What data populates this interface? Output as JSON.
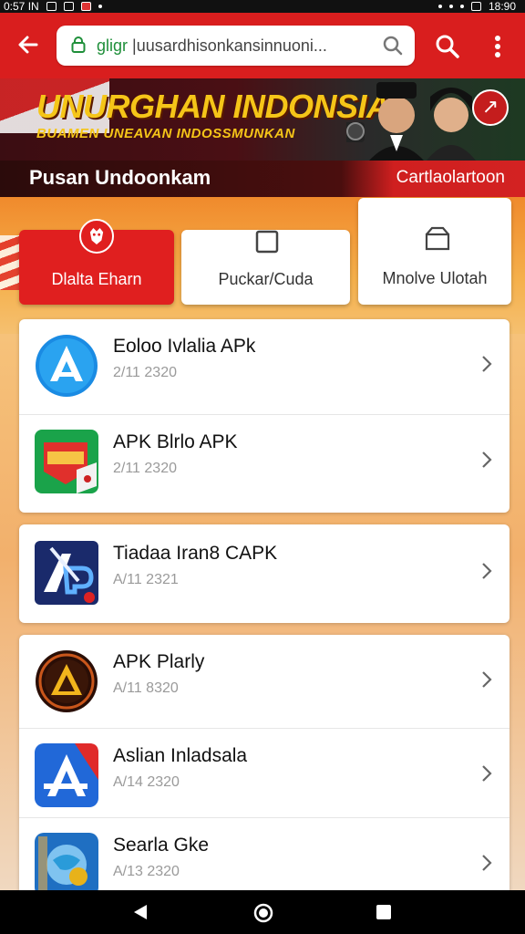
{
  "status": {
    "time_left": "0:57 IN",
    "time_right": "18:90"
  },
  "browser": {
    "url_prefix": "gligr",
    "url_rest": "|uusardhisonkansinnuoni..."
  },
  "banner": {
    "headline": "UNURGHAN INDONSIA",
    "subline": "BUAMEN UNEAVAN INDOSSMUNKAN",
    "bottom_left": "Pusan Undoonkam",
    "bottom_right": "Cartlaolartoon"
  },
  "tabs": [
    {
      "label": "Dlalta Eharn",
      "icon": "lion-emblem-icon"
    },
    {
      "label": "Puckar/Cuda",
      "icon": "square-icon"
    },
    {
      "label": "Mnolve Ulotah",
      "icon": "box-icon"
    }
  ],
  "apps": [
    {
      "name": "Eoloo Ivlalia APk",
      "date": "2/11 2320",
      "icon": "blue-a-circle-icon"
    },
    {
      "name": "APK Blrlo APK",
      "date": "2/11 2320",
      "icon": "green-red-tile-icon"
    },
    {
      "name": "Tiadaa Iran8 CAPK",
      "date": "A/11 2321",
      "icon": "navy-ap-icon"
    },
    {
      "name": "APK Plarly",
      "date": "A/11 8320",
      "icon": "gold-a-medallion-icon"
    },
    {
      "name": "Aslian Inladsala",
      "date": "A/14 2320",
      "icon": "blue-red-a-icon"
    },
    {
      "name": "Searla Gke",
      "date": "A/13 2320",
      "icon": "blue-globe-icon"
    }
  ],
  "colors": {
    "primary": "#d91e1e",
    "accent": "#f5c518"
  }
}
